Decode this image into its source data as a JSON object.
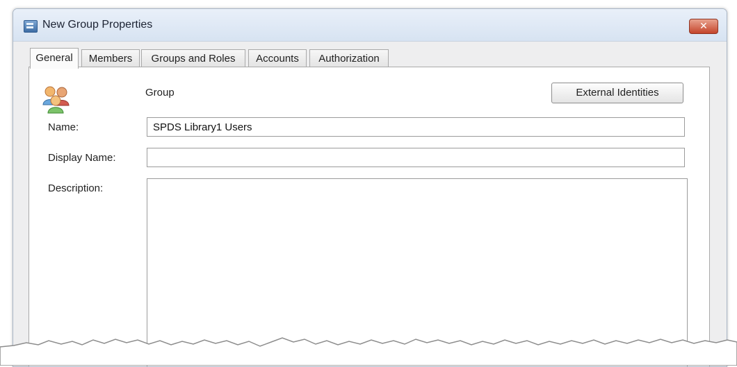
{
  "window": {
    "title": "New Group Properties",
    "close_glyph": "✕"
  },
  "tabs": [
    {
      "label": "General",
      "active": true
    },
    {
      "label": "Members",
      "active": false
    },
    {
      "label": "Groups and Roles",
      "active": false
    },
    {
      "label": "Accounts",
      "active": false
    },
    {
      "label": "Authorization",
      "active": false
    }
  ],
  "general": {
    "type_label": "Group",
    "external_identities_label": "External Identities",
    "name_label": "Name:",
    "name_value": "SPDS Library1 Users",
    "display_name_label": "Display Name:",
    "display_name_value": "",
    "description_label": "Description:",
    "description_value": ""
  },
  "icons": {
    "window": "window-icon",
    "group": "group-users-icon",
    "close": "close-icon"
  },
  "colors": {
    "titlebar": "#dbe6f3",
    "close_button": "#c4452b",
    "panel_background": "#ffffff",
    "window_background": "#eeeeef"
  }
}
